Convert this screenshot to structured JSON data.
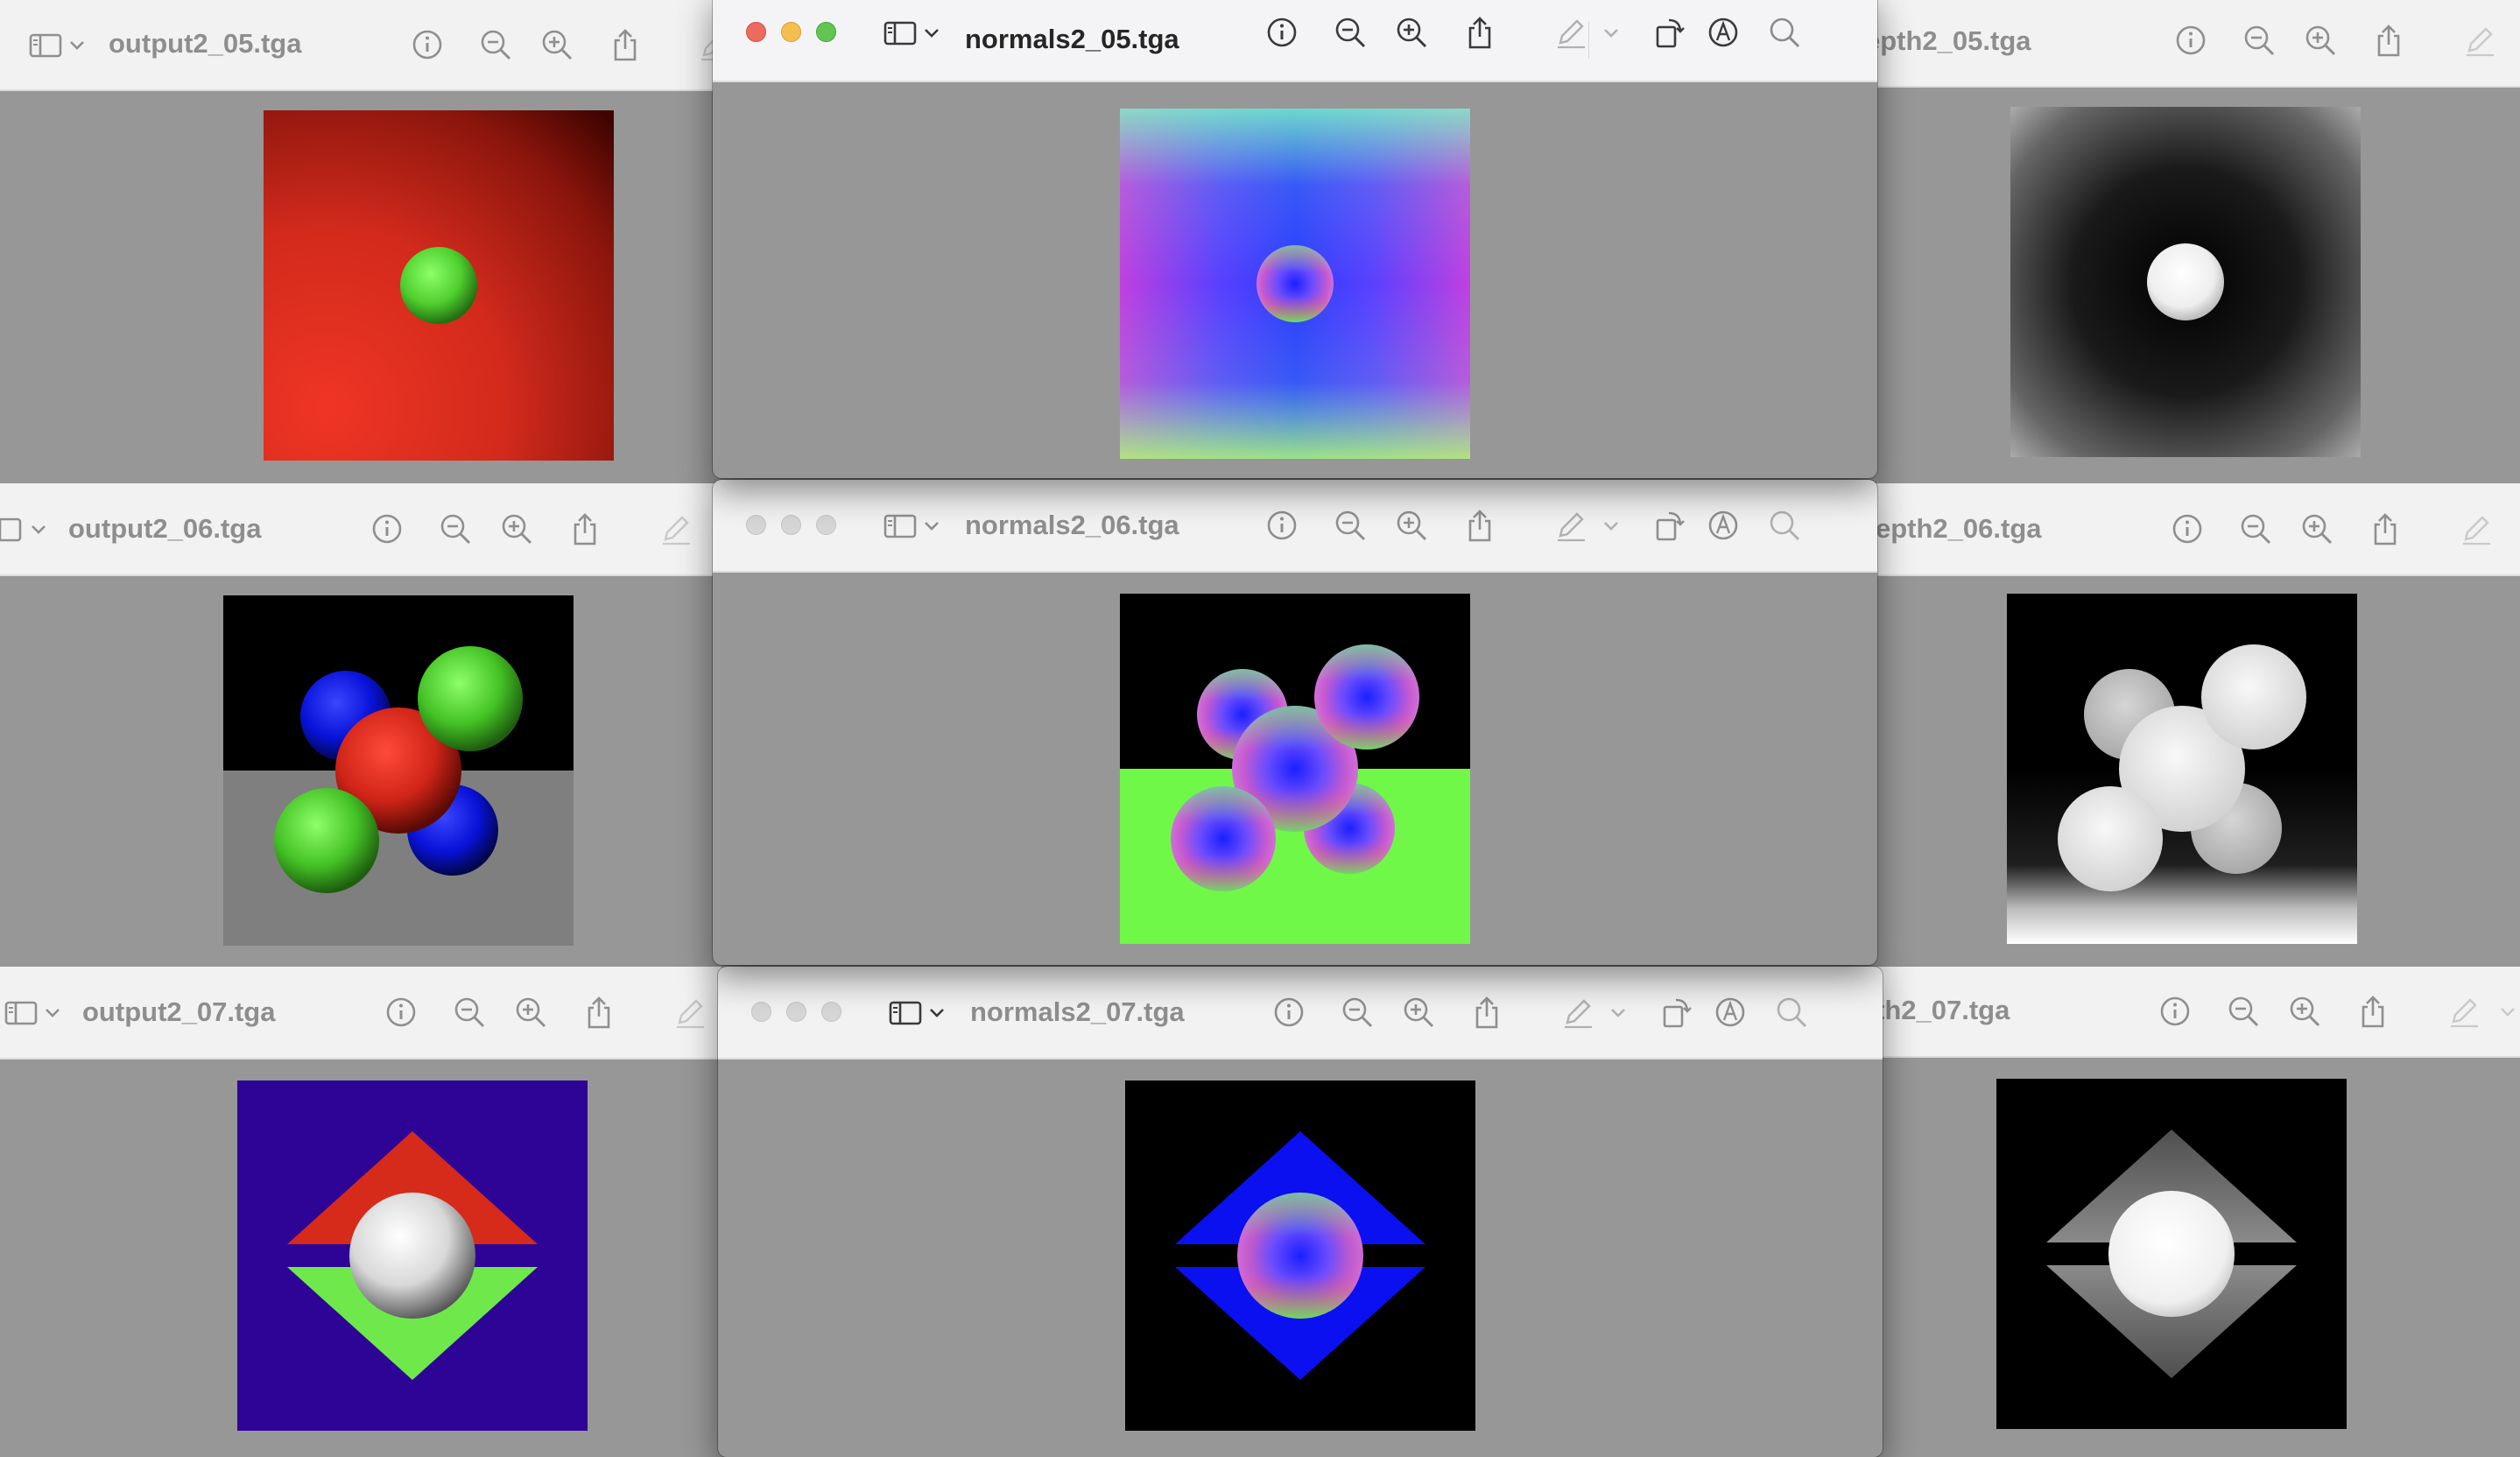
{
  "windows": {
    "output2_05": {
      "title": "output2_05.tga"
    },
    "normals2_05": {
      "title": "normals2_05.tga"
    },
    "depth2_05": {
      "title": "epth2_05.tga"
    },
    "output2_06": {
      "title": "output2_06.tga"
    },
    "normals2_06": {
      "title": "normals2_06.tga"
    },
    "depth2_06": {
      "title": "epth2_06.tga"
    },
    "output2_07": {
      "title": "output2_07.tga"
    },
    "normals2_07": {
      "title": "normals2_07.tga"
    },
    "depth2_07": {
      "title": "th2_07.tga"
    }
  },
  "toolbar_icons": [
    "sidebar-toggle-icon",
    "chevron-down-icon",
    "info-icon",
    "zoom-out-icon",
    "zoom-in-icon",
    "share-icon",
    "markup-pen-icon",
    "rotate-icon",
    "annotate-icon",
    "search-icon"
  ],
  "colors": {
    "window_background": "#979797",
    "toolbar_background": "#f4f4f6",
    "close": "#ec6a5e",
    "minimize": "#f4bf4f",
    "zoom": "#61c554",
    "render_red": "#e03020",
    "render_green": "#6cf04a",
    "render_blue": "#0a14f0",
    "render_purple": "#2e0496"
  }
}
